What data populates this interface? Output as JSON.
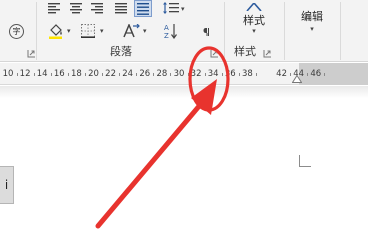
{
  "ribbon": {
    "paragraph_group_label": "段落",
    "styles_button_label": "样式",
    "styles_group_label": "样式",
    "editing_button_label": "编辑",
    "phonetic_glyph": "字"
  },
  "ruler": {
    "labels": [
      "10",
      "12",
      "14",
      "16",
      "18",
      "20",
      "22",
      "24",
      "26",
      "28",
      "30",
      "32",
      "34",
      "36",
      "38",
      "42",
      "44",
      "46"
    ]
  },
  "document": {
    "side_tab_text": "i"
  },
  "colors": {
    "annotation": "#e8332e",
    "ribbon_bg": "#f3f3f3",
    "accent_blue": "#2e5c9e"
  }
}
